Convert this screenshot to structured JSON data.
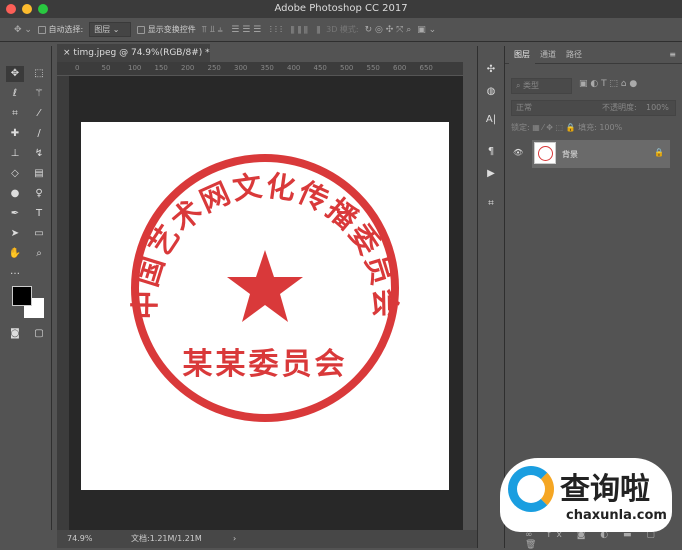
{
  "window": {
    "title": "Adobe Photoshop CC 2017"
  },
  "options": {
    "auto_select_label": "自动选择:",
    "auto_select_value": "图层",
    "show_transform_label": "显示变换控件",
    "mode_3d": "3D 模式:"
  },
  "document": {
    "tab_title": "timg.jpeg @ 74.9%(RGB/8#) *",
    "close": "×",
    "ruler_ticks": [
      "0",
      "50",
      "100",
      "150",
      "200",
      "250",
      "300",
      "350",
      "400",
      "450",
      "500",
      "550",
      "600",
      "650"
    ]
  },
  "stamp": {
    "arc_text": "中国艺术网文化传播委员会",
    "bottom_text": "某某委员会",
    "color": "#d9393a"
  },
  "status": {
    "zoom": "74.9%",
    "doc_size": "文档:1.21M/1.21M",
    "arrow": "›"
  },
  "panel": {
    "tabs": [
      "图层",
      "通道",
      "路径"
    ],
    "filter_kind": "类型",
    "blend_mode": "正常",
    "opacity_label": "不透明度:",
    "opacity_value": "100%",
    "lock_label": "锁定:",
    "fill_label": "填充:",
    "fill_value": "100%",
    "layer_name": "背景"
  },
  "watermark": {
    "name": "查询啦",
    "url": "chaxunla.com"
  }
}
